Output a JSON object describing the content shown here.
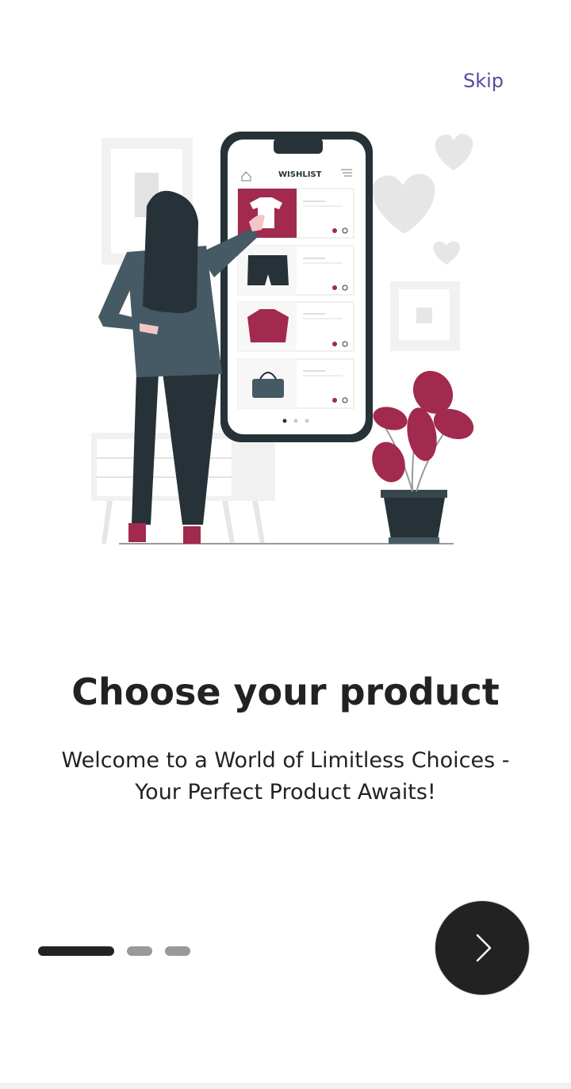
{
  "skip_label": "Skip",
  "title": "Choose your product",
  "subtitle_line1": "Welcome to a World of Limitless Choices -",
  "subtitle_line2": "Your Perfect Product Awaits!",
  "illustration": {
    "phone_header": "WISHLIST"
  },
  "pagination": {
    "total": 3,
    "active_index": 0
  },
  "next_button": {
    "icon": "chevron-right-icon"
  },
  "colors": {
    "accent": "#a12a4e",
    "dark": "#222222",
    "skip": "#5b4a9b"
  }
}
